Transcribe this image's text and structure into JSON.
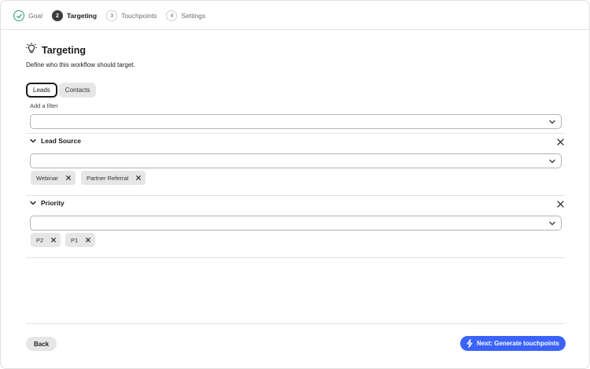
{
  "stepper": {
    "steps": [
      {
        "num": "",
        "label": "Goal",
        "state": "done"
      },
      {
        "num": "2",
        "label": "Targeting",
        "state": "active"
      },
      {
        "num": "3",
        "label": "Touchpoints",
        "state": "todo"
      },
      {
        "num": "4",
        "label": "Settings",
        "state": "todo"
      }
    ]
  },
  "header": {
    "icon": "lightbulb-icon",
    "title": "Targeting",
    "subtitle": "Define who this workflow should target."
  },
  "segment": {
    "options": [
      "Leads",
      "Contacts"
    ],
    "selected": "Leads"
  },
  "filter": {
    "label": "Add a filter",
    "value": ""
  },
  "sections": [
    {
      "title": "Lead Source",
      "value": "",
      "tags": [
        "Webinar",
        "Partner Referral"
      ]
    },
    {
      "title": "Priority",
      "value": "",
      "tags": [
        "P2",
        "P1"
      ]
    }
  ],
  "footer": {
    "back_label": "Back",
    "next_label": "Next: Generate touchpoints"
  },
  "colors": {
    "accent": "#3b63fb",
    "success": "#2d9d78",
    "active_step": "#3b3b3b"
  }
}
